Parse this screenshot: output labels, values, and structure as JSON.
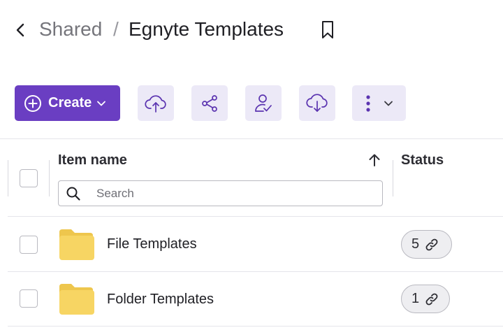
{
  "breadcrumb": {
    "parent": "Shared",
    "separator": "/",
    "current": "Egnyte Templates"
  },
  "toolbar": {
    "create_label": "Create",
    "icons": [
      "upload-cloud-icon",
      "share-icon",
      "user-check-icon",
      "download-cloud-icon",
      "more-vertical-icon"
    ]
  },
  "table": {
    "columns": {
      "name": "Item name",
      "status": "Status"
    },
    "sort_direction": "ascending",
    "search": {
      "placeholder": "Search",
      "value": ""
    },
    "rows": [
      {
        "name": "File Templates",
        "status_count": "5",
        "type": "folder"
      },
      {
        "name": "Folder Templates",
        "status_count": "1",
        "type": "folder"
      }
    ]
  },
  "colors": {
    "accent": "#6a3ec2",
    "tool_bg": "#ece9f7",
    "folder": "#f7d563",
    "folder_tab": "#eec64d"
  }
}
